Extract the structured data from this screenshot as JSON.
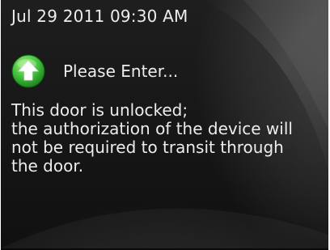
{
  "header": {
    "datetime": "Jul 29 2011 09:30 AM"
  },
  "status": {
    "icon": "green-up-arrow-icon",
    "icon_color": "#3fbf3a",
    "text": "Please Enter..."
  },
  "message": {
    "lines": [
      "This door is unlocked;",
      "the authorization of the device will",
      "not be required to transit through",
      "the door."
    ]
  },
  "colors": {
    "background": "#161616",
    "text": "#ececec"
  }
}
